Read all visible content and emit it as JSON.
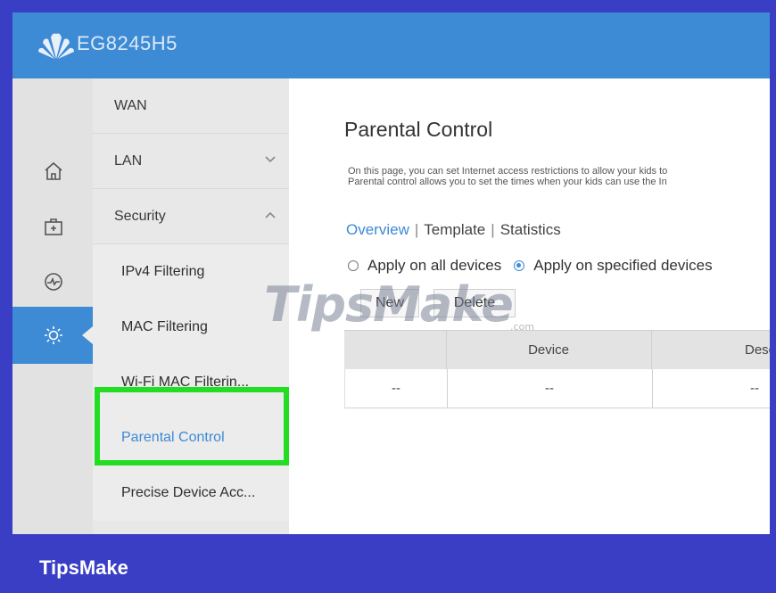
{
  "header": {
    "device_name": "EG8245H5"
  },
  "iconbar": {
    "items": [
      "home-icon",
      "toolbox-icon",
      "diagnosis-icon",
      "settings-icon"
    ],
    "active": "settings-icon"
  },
  "menu": {
    "items": [
      "WAN",
      "LAN",
      "Security"
    ],
    "security_sub": [
      "IPv4 Filtering",
      "MAC Filtering",
      "Wi-Fi MAC Filterin...",
      "Parental Control",
      "Precise Device Acc..."
    ],
    "selected": "Parental Control"
  },
  "content": {
    "title": "Parental Control",
    "description_line1": "On this page, you can set Internet access restrictions to allow your kids to",
    "description_line2": "Parental control allows you to set the times when your kids can use the In",
    "tabs": [
      "Overview",
      "Template",
      "Statistics"
    ],
    "tab_active": "Overview",
    "radio_all": "Apply on all devices",
    "radio_specified": "Apply on specified devices",
    "radio_selected": "Apply on specified devices",
    "new_button": "New",
    "delete_button": "Delete",
    "table": {
      "headers": [
        "",
        "Device",
        "Descript"
      ],
      "rows": [
        [
          "--",
          "--",
          "--"
        ]
      ]
    }
  },
  "watermark": {
    "text": "TipsMake",
    "suffix": ".com"
  },
  "footer": {
    "brand": "TipsMake"
  },
  "colors": {
    "accent": "#3d8bd5",
    "highlight": "#22dd22",
    "frame": "#3a3ec4"
  }
}
